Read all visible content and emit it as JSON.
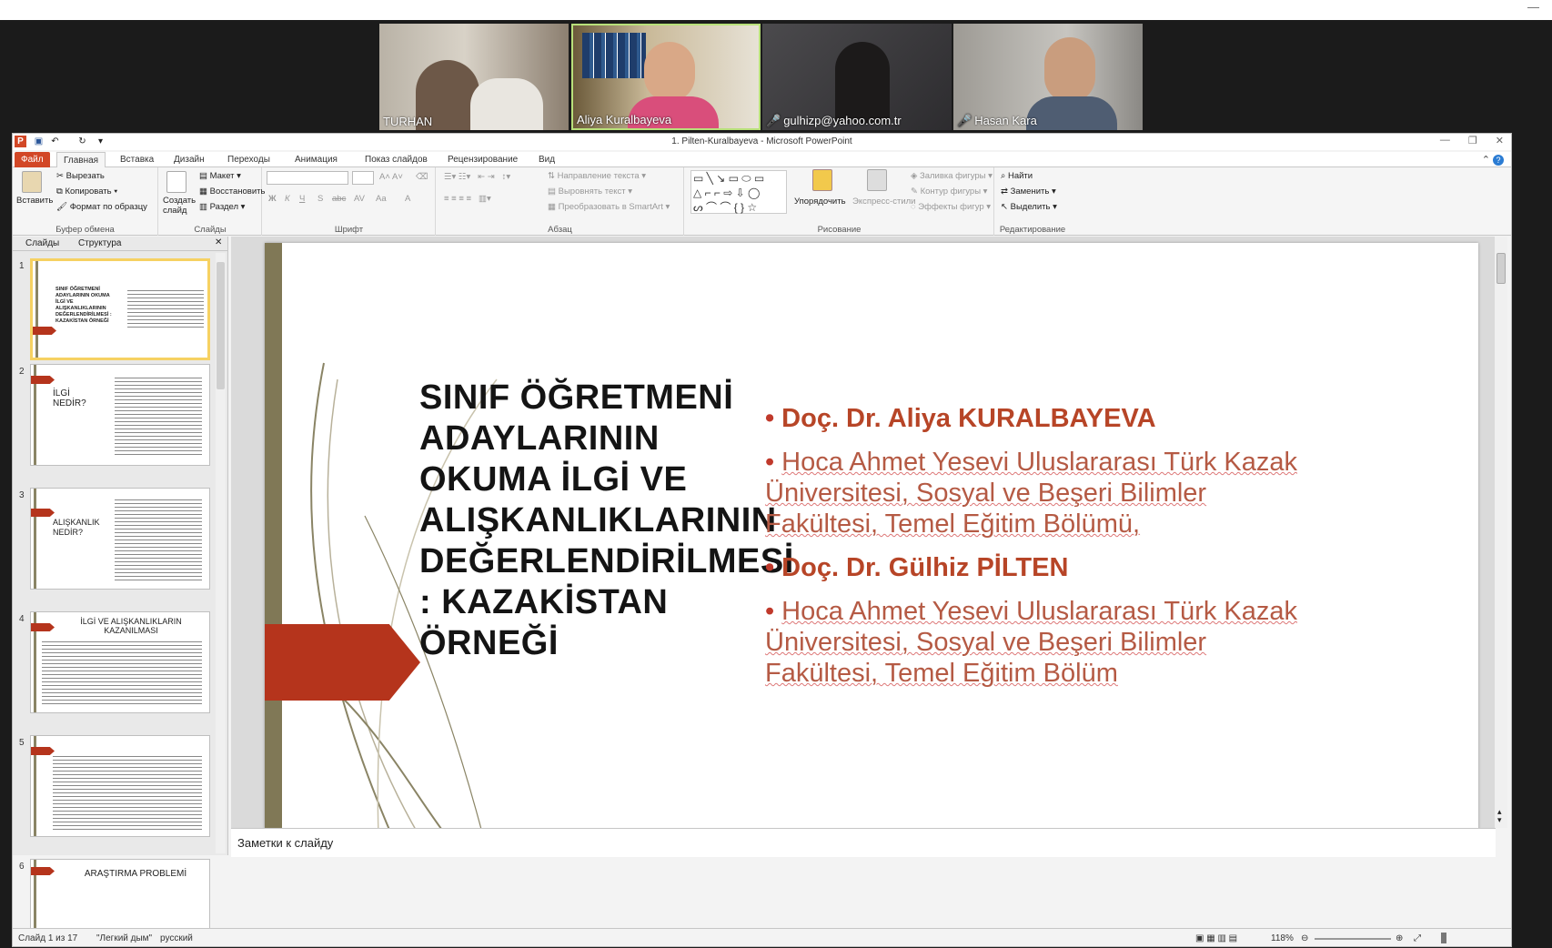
{
  "meeting": {
    "participants": [
      {
        "name": "TURHAN",
        "muted": false
      },
      {
        "name": "Aliya Kuralbayeva",
        "muted": false
      },
      {
        "name": "gulhizp@yahoo.com.tr",
        "muted": true
      },
      {
        "name": "Hasan Kara",
        "muted": true
      }
    ]
  },
  "window": {
    "title": "1. Pilten-Kuralbayeva - Microsoft PowerPoint",
    "controls": [
      "—",
      "❐",
      "✕"
    ]
  },
  "tabs": [
    "Файл",
    "Главная",
    "Вставка",
    "Дизайн",
    "Переходы",
    "Анимация",
    "Показ слайдов",
    "Рецензирование",
    "Вид"
  ],
  "ribbon": {
    "clipboard": {
      "label": "Буфер обмена",
      "paste": "Вставить",
      "cut": "Вырезать",
      "copy": "Копировать",
      "format_painter": "Формат по образцу"
    },
    "slides": {
      "label": "Слайды",
      "new_slide": "Создать слайд",
      "layout": "Макет",
      "reset": "Восстановить",
      "section": "Раздел"
    },
    "font": {
      "label": "Шрифт",
      "buttons": [
        "Ж",
        "К",
        "Ч",
        "S",
        "abc",
        "AV",
        "Aa",
        "A"
      ]
    },
    "paragraph": {
      "label": "Абзац",
      "text_direction": "Направление текста",
      "align_text": "Выровнять текст",
      "smartart": "Преобразовать в SmartArt"
    },
    "drawing": {
      "label": "Рисование",
      "arrange": "Упорядочить",
      "quick_styles": "Экспресс-стили",
      "fill": "Заливка фигуры",
      "outline": "Контур фигуры",
      "effects": "Эффекты фигур"
    },
    "editing": {
      "label": "Редактирование",
      "find": "Найти",
      "replace": "Заменить",
      "select": "Выделить"
    }
  },
  "panel": {
    "tabs": [
      "Слайды",
      "Структура"
    ],
    "thumbnails": [
      {
        "no": "1",
        "title": "SINIF ÖĞRETMENİ ADAYLARININ OKUMA İLGİ VE ALIŞKANLIKLARININ DEĞERLENDİRİLMESİ : KAZAKİSTAN ÖRNEĞİ"
      },
      {
        "no": "2",
        "title": "İLGİ NEDİR?"
      },
      {
        "no": "3",
        "title": "ALIŞKANLIK NEDİR?"
      },
      {
        "no": "4",
        "title": "İLGİ VE ALIŞKANLIKLARIN KAZANILMASI"
      },
      {
        "no": "5",
        "title": ""
      },
      {
        "no": "6",
        "title": "ARAŞTIRMA PROBLEMİ"
      }
    ]
  },
  "slide": {
    "title": "SINIF ÖĞRETMENİ ADAYLARININ OKUMA İLGİ VE ALIŞKANLIKLARININ DEĞERLENDİRİLMESİ : KAZAKİSTAN ÖRNEĞİ",
    "bullets": [
      {
        "text": "Doç. Dr. Aliya KURALBAYEVA",
        "kind": "name"
      },
      {
        "text": "Hoca Ahmet Yesevi Uluslararası Türk Kazak Üniversitesi, Sosyal ve Beşeri Bilimler Fakültesi, Temel Eğitim Bölümü,",
        "kind": "aff"
      },
      {
        "text": "Doç. Dr. Gülhiz PİLTEN",
        "kind": "name"
      },
      {
        "text": "Hoca Ahmet Yesevi Uluslararası Türk Kazak Üniversitesi, Sosyal ve Beşeri Bilimler Fakültesi, Temel Eğitim Bölüm",
        "kind": "aff"
      }
    ],
    "accent_color": "#b5341c",
    "bar_color": "#807856"
  },
  "notes": {
    "placeholder": "Заметки к слайду"
  },
  "status": {
    "slide_info": "Слайд 1 из 17",
    "theme": "\"Легкий дым\"",
    "language": "русский",
    "zoom": "118%"
  }
}
